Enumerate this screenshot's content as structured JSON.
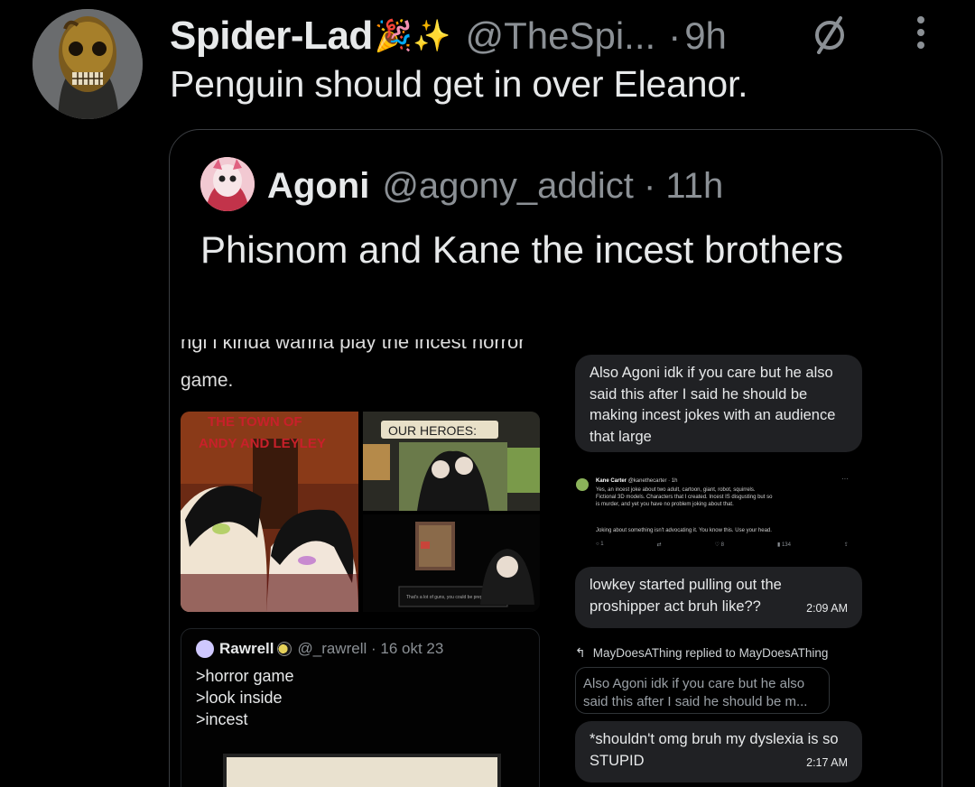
{
  "author": {
    "display_name": "Spider-Lad",
    "name_emojis": "🎉✨",
    "handle": "@TheSpi...",
    "separator": "·",
    "time": "9h"
  },
  "tweet": {
    "text": "Penguin should get in over Eleanor."
  },
  "quoted": {
    "display_name": "Agoni",
    "handle": "@agony_addict · 11h",
    "text": "Phisnom and Kane the incest brothers",
    "embed": {
      "top_text_cut": "ngi i kinda wanna play the incest horror",
      "top_text_line2": "game.",
      "image_labels": {
        "a": "THE TOWN OF ANDY AND LEYLEY",
        "b": "OUR HEROES:",
        "c": "That's a lot of guns, you could be prepared"
      },
      "inner_quote": {
        "name": "Rawrell",
        "handle": "@_rawrell · 16 okt 23",
        "lines": [
          ">horror game",
          ">look inside",
          ">incest"
        ]
      },
      "chat": {
        "bubble1": "Also Agoni idk if you care but he also said this after I said he should be making incest jokes with an audience that large",
        "screenshot": {
          "name": "Kane Carter",
          "handle": "@kanethecarter · 1h",
          "lines": [
            "Yes, an incest joke about two adult, cartoon, giant, robot, squirrels.",
            "Fictional 3D models. Characters that I created. Incest IS disgusting but so",
            "is murder, and yet you have no problem joking about that.",
            "",
            "Joking about something isn't advocating it. You know this. Use your head."
          ],
          "actions": [
            "1",
            "",
            "8",
            "134",
            ""
          ]
        },
        "bubble2": "lowkey started pulling out the proshipper act bruh like??",
        "bubble2_time": "2:09 AM",
        "reply_meta": "MayDoesAThing replied to MayDoesAThing",
        "reply_quote": "Also Agoni idk if you care but he also said this after I said he should be m...",
        "bubble3": "*shouldn't omg bruh my dyslexia is so STUPID",
        "bubble3_time": "2:17 AM"
      }
    }
  },
  "colors": {
    "background": "#000000",
    "text": "#e7e9ea",
    "secondary": "#8b9095",
    "border": "#3a3d41",
    "bubble": "#202124"
  },
  "icons": {
    "muted": "muted-circle-slash-icon",
    "more": "more-vertical-icon",
    "reply": "reply-arrow-icon"
  }
}
